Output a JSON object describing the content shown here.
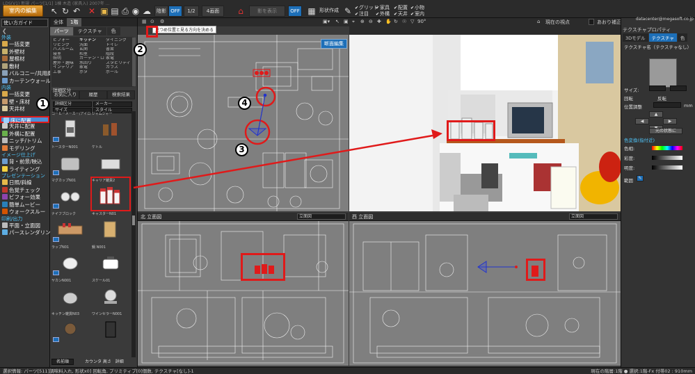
{
  "topbar": {
    "caption": "LDS(V1) 新規 パーツ[1/1] 1棟 木造 (家具入)  2007年 ...  ",
    "mode_button": "室内の編集",
    "zoom_level": "1/2",
    "shading_label": "陰影",
    "off": "OFF",
    "view_label": "4画面",
    "light_label": "影を表示",
    "shape_label": "形状作成",
    "checks": [
      "グリッド",
      "柱",
      "配置",
      "天井",
      "家具",
      "小物",
      "天井",
      "室内"
    ],
    "check_labels": {
      "c1": "グリッド",
      "c2": "注目",
      "c3": "家具",
      "c4": "外構",
      "c5": "配置",
      "c6": "天井",
      "c7": "小物",
      "c8": "室内"
    }
  },
  "leftbar": {
    "guide": "使い方ガイド",
    "sec_outer": "外装",
    "outer_items": [
      "一括変更",
      "外壁材",
      "屋根材",
      "敷材",
      "バルコニー/共用廊下",
      "カーテンウォール"
    ],
    "sec_inner": "内装",
    "inner_items": [
      "一括変更",
      "壁・床材",
      "天井材"
    ],
    "selected_item": "床に配置",
    "place_items": [
      "天井に配置",
      "外構に配置",
      "ニッチ/トリム",
      "モデリング"
    ],
    "sec_image": "イメージ仕上げ",
    "image_items": [
      "背・前景/映込",
      "ライティング"
    ],
    "sec_present": "プレゼンテーション",
    "present_items": [
      "日照/斜線",
      "色覚チェック",
      "ビフォー効果",
      "簡単ムービー",
      "ウォークスルー"
    ],
    "sec_print": "印刷/出力",
    "print_items": [
      "平面・立面図",
      "パースレンダリング"
    ]
  },
  "parts": {
    "tabs": [
      "全体",
      "1階"
    ],
    "tabs2": [
      "パーツ",
      "テクスチャ",
      "色"
    ],
    "cat_col1": [
      "ビフォー",
      "リビング",
      "バスルーム",
      "寝室",
      "照明",
      "屋外・趣味",
      "インテリア",
      "工事"
    ],
    "cat_col2": [
      "キッチン",
      "洗面",
      "玄関",
      "和室",
      "カーテン・ロ",
      "水回り",
      "家電",
      "ボタ"
    ],
    "cat_col3": [
      "ダイニング",
      "トイレ",
      "書斎",
      "階段",
      "家電",
      "スタビリティ",
      "ガラス",
      "ボール"
    ],
    "subtabs": [
      "お気に入り",
      "履歴",
      "検索結果"
    ],
    "filter1": "詳細区分",
    "filter2": "メーカー",
    "filter3": "サイズ",
    "filter4": "スタイル",
    "thumbs": [
      "コーヒーメーカー/アイロ",
      "ジャムジャー",
      "トースターN001",
      "ケトル",
      "マグカップN01",
      "キャリア雑貨2",
      "ナイフブロック",
      "キャスターN01",
      "ラップN01",
      "ラップ N002",
      "鍋 N001",
      "スケール01",
      "ヤカンN001",
      "キッチン雑貨N03",
      "ワインセラーN001",
      "フライパンN002",
      "フォークN001",
      "パンN002"
    ],
    "bottom": "名前順",
    "bottom2": "カウンタ 高さ",
    "bottom3": "詳細"
  },
  "tooltip": "見つめ位置と見る方向を決める",
  "views": {
    "plan_button": "断面編集",
    "persp_point": "現在の視点",
    "persp_sub": "あおり補正",
    "angle": "90°",
    "elev1_title": "北 立面図",
    "elev1_select": "立面図",
    "elev2_title": "西 立面図",
    "elev2_select": "立面図"
  },
  "rightpanel": {
    "email": "datacenter@megasoft.co.jp",
    "help": "データセンター",
    "title": "テクスチャプロパティ",
    "tabs": [
      "3Dモデル",
      "テクスチャ",
      "色"
    ],
    "tex_name": "テクスチャ名（テクスチャなし）",
    "size": "サイズ:",
    "rotate": "回転",
    "reverse": "反転",
    "pos": "位置調整",
    "unit": "mm",
    "reset": "元の状態に",
    "color_section": "色変換(指付近)",
    "hue": "色相:",
    "sat": "彩度:",
    "lum": "明度:",
    "range": "範囲"
  },
  "status": {
    "left": "選択情報: パーツ[511]調味料入れ, 形状x0] 回転角, プリミティブ[0]個数, テクスチャ[なし]-1",
    "right": "現在の階層:1階 ● 選択:1階-Fx 付帯02 : 910mm"
  },
  "annotations": [
    "1",
    "2",
    "3",
    "4"
  ],
  "colors": {
    "accent": "#1d6fb8",
    "highlight": "#e01a1a",
    "selected": "#4b8fd6",
    "mode": "#d98b1e"
  }
}
